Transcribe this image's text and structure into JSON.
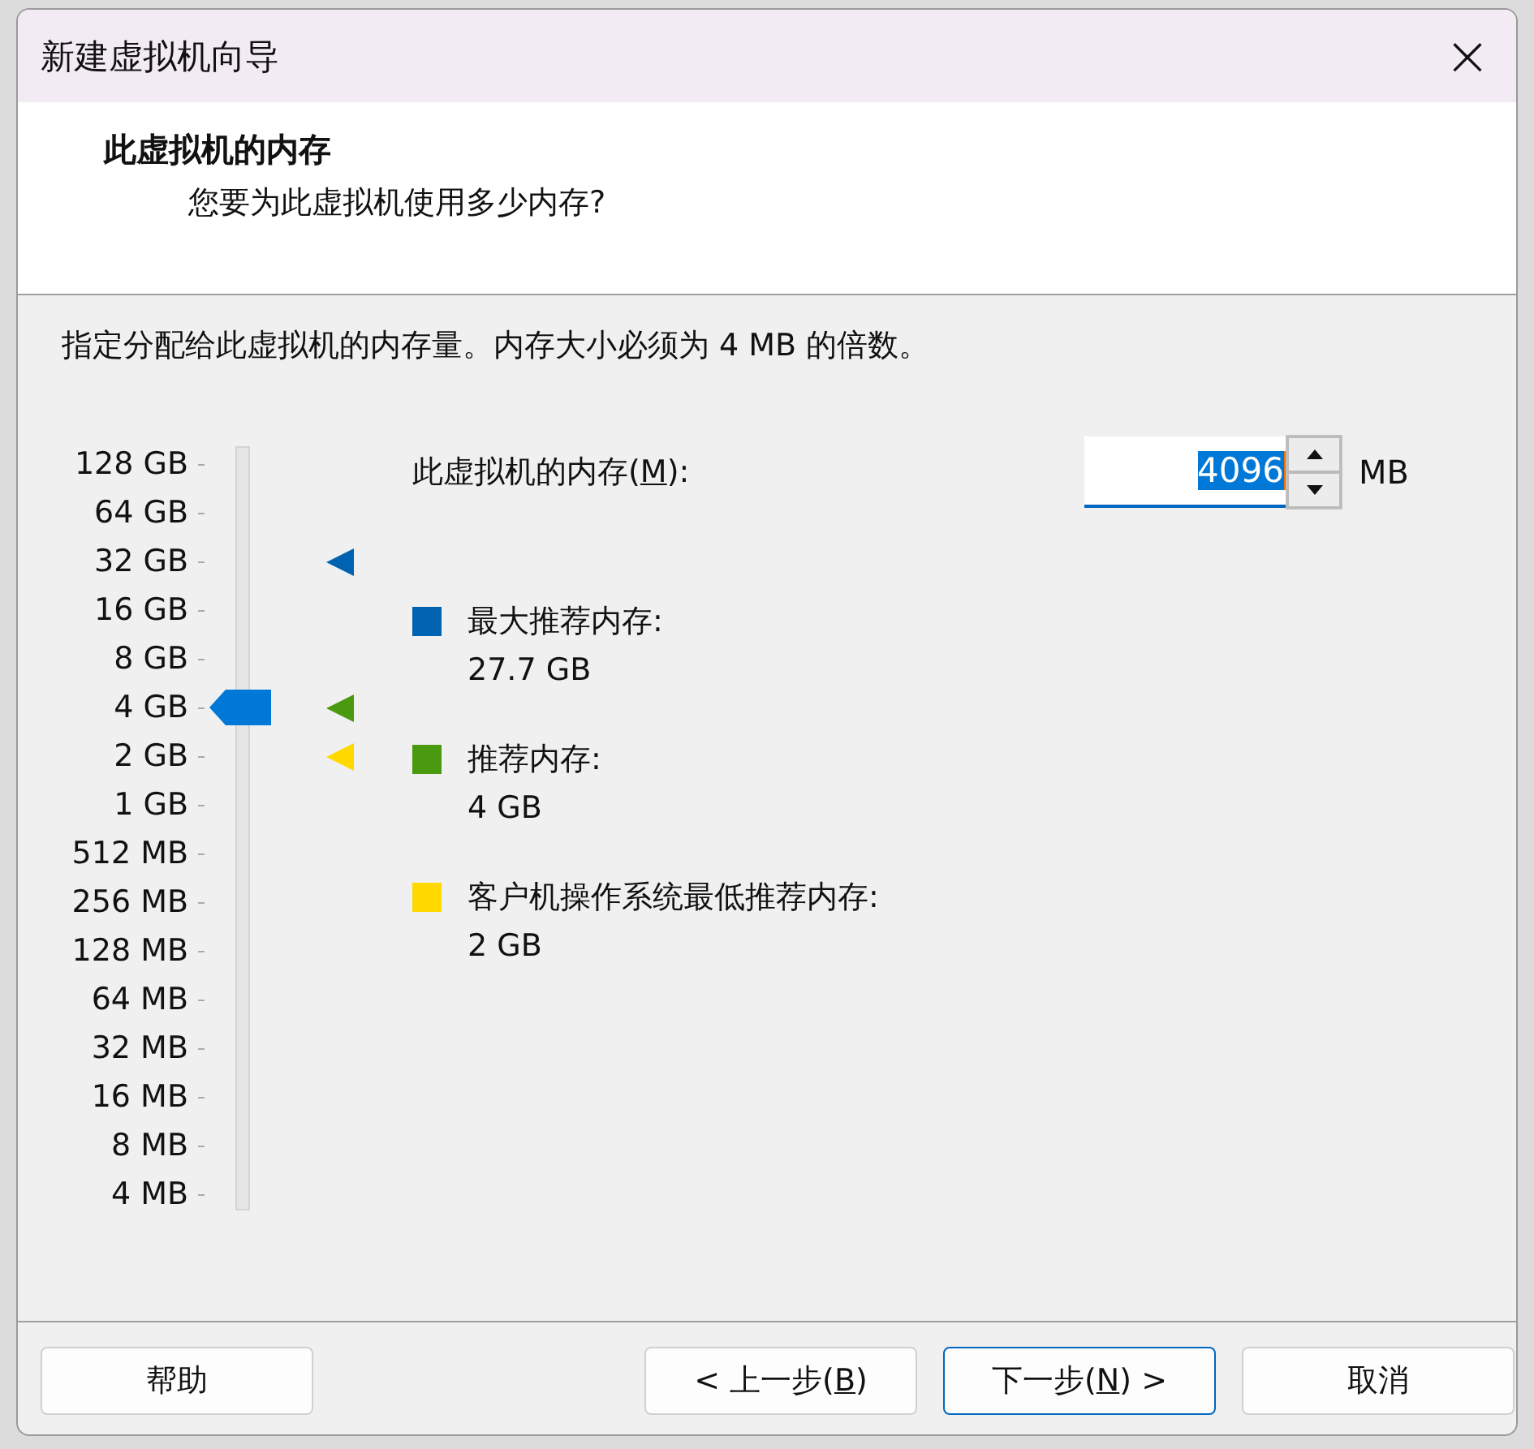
{
  "window": {
    "title": "新建虚拟机向导",
    "close": "×"
  },
  "header": {
    "title": "此虚拟机的内存",
    "subtitle": "您要为此虚拟机使用多少内存?"
  },
  "description": "指定分配给此虚拟机的内存量。内存大小必须为 4 MB 的倍数。",
  "slider": {
    "level": 0.6667,
    "ticks": [
      {
        "label": "128 GB"
      },
      {
        "label": "64 GB"
      },
      {
        "label": "32 GB",
        "color": "#0063b1"
      },
      {
        "label": "16 GB"
      },
      {
        "label": "8 GB"
      },
      {
        "label": "4 GB",
        "color": "#4a9a10"
      },
      {
        "label": "2 GB",
        "color": "#ffd800"
      },
      {
        "label": "1 GB"
      },
      {
        "label": "512 MB"
      },
      {
        "label": "256 MB"
      },
      {
        "label": "128 MB"
      },
      {
        "label": "64 MB"
      },
      {
        "label": "32 MB"
      },
      {
        "label": "16 MB"
      },
      {
        "label": "8 MB"
      },
      {
        "label": "4 MB"
      }
    ]
  },
  "memory": {
    "label": [
      "此虚拟机的内存(",
      "M",
      "):"
    ],
    "value": "4096",
    "text_selected": true,
    "unit": "MB"
  },
  "legend": [
    {
      "label": "最大推荐内存:",
      "value": "27.7 GB",
      "color": "#0063b1"
    },
    {
      "label": "推荐内存:",
      "value": "4 GB",
      "color": "#4a9a10"
    },
    {
      "label": "客户机操作系统最低推荐内存:",
      "value": "2 GB",
      "color": "#ffd800"
    }
  ],
  "buttons": [
    {
      "label": [
        "帮助"
      ],
      "focused": false
    },
    {
      "label": [
        "< 上一步(",
        "B",
        ")"
      ],
      "focused": false
    },
    {
      "label": [
        "下一步(",
        "N",
        ") >"
      ],
      "focused": true
    },
    {
      "label": [
        "取消"
      ],
      "focused": false
    }
  ]
}
